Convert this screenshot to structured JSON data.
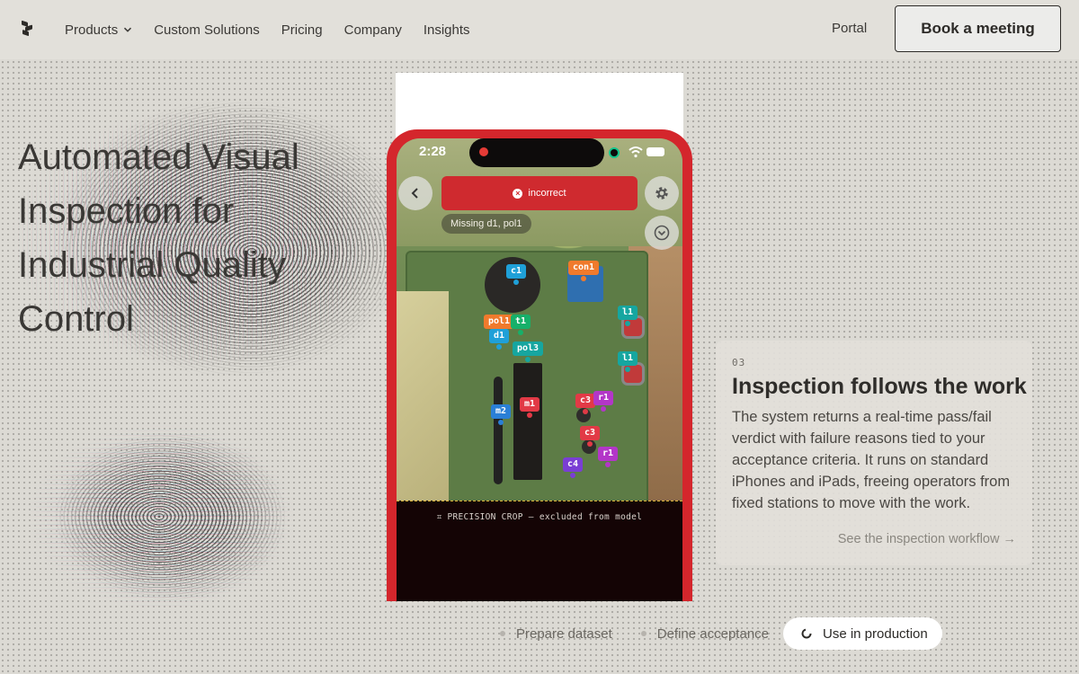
{
  "nav": {
    "items": [
      {
        "label": "Products",
        "has_dropdown": true
      },
      {
        "label": "Custom Solutions"
      },
      {
        "label": "Pricing"
      },
      {
        "label": "Company"
      },
      {
        "label": "Insights"
      }
    ],
    "portal_label": "Portal",
    "book_label": "Book a meeting"
  },
  "hero": {
    "title": "Automated Visual Inspection for Industrial Quality Control"
  },
  "phone": {
    "time": "2:28",
    "verdict_label": "incorrect",
    "missing_text": "Missing d1, pol1",
    "crop_label": "PRECISION CROP — excluded from model",
    "tags": [
      {
        "label": "c1",
        "color": "#1fa0d8"
      },
      {
        "label": "con1",
        "color": "#f07a2c"
      },
      {
        "label": "pol1",
        "color": "#f07a2c"
      },
      {
        "label": "t1",
        "color": "#16b06a"
      },
      {
        "label": "d1",
        "color": "#1fa0d8"
      },
      {
        "label": "pol3",
        "color": "#16a6a0"
      },
      {
        "label": "l1",
        "color": "#16a6a0"
      },
      {
        "label": "l1",
        "color": "#16a6a0"
      },
      {
        "label": "m2",
        "color": "#2a7fd6"
      },
      {
        "label": "m1",
        "color": "#e23a46"
      },
      {
        "label": "c3",
        "color": "#e23a46"
      },
      {
        "label": "r1",
        "color": "#b336c8"
      },
      {
        "label": "c3",
        "color": "#e23a46"
      },
      {
        "label": "r1",
        "color": "#b336c8"
      },
      {
        "label": "c4",
        "color": "#7a3ed4"
      }
    ]
  },
  "card": {
    "number": "03",
    "title": "Inspection follows the work",
    "body": "The system returns a real-time pass/fail verdict with failure reasons tied to your acceptance criteria. It runs on standard iPhones and iPads, freeing operators from fixed stations to move with the work.",
    "link": "See the inspection workflow →"
  },
  "steps": [
    {
      "label": "Prepare dataset",
      "active": false
    },
    {
      "label": "Define acceptance",
      "active": false
    },
    {
      "label": "Use in production",
      "active": true
    }
  ]
}
